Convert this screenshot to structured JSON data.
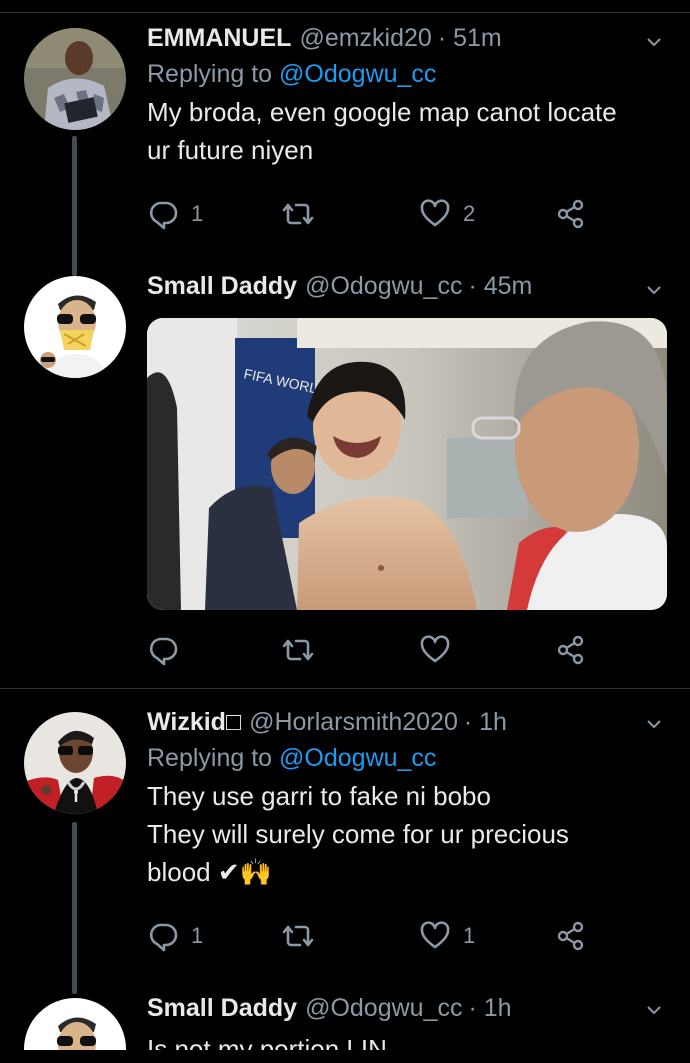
{
  "tweets": [
    {
      "name": "EMMANUEL",
      "handle": "@emzkid20",
      "time": "· 51m",
      "replying_prefix": "Replying to",
      "replying_to": "@Odogwu_cc",
      "text_lines": [
        "My broda, even google map canot locate",
        "ur future niyen"
      ],
      "reply_count": "1",
      "retweet_count": "",
      "like_count": "2"
    },
    {
      "name": "Small Daddy",
      "handle": "@Odogwu_cc",
      "time": "· 45m",
      "reply_count": "",
      "retweet_count": "",
      "like_count": ""
    },
    {
      "name": "Wizkid",
      "name_suffix": "□",
      "handle": "@Horlarsmith2020",
      "time": "· 1h",
      "replying_prefix": "Replying to",
      "replying_to": "@Odogwu_cc",
      "text_lines": [
        "They use garri to fake ni bobo",
        "They will surely come for ur precious",
        "blood ✔🙌"
      ],
      "reply_count": "1",
      "retweet_count": "",
      "like_count": "1"
    },
    {
      "name": "Small Daddy",
      "handle": "@Odogwu_cc",
      "time": "· 1h",
      "text_lines": [
        "Is not my portion LIN"
      ]
    }
  ],
  "icons": {
    "reply": "reply-icon",
    "retweet": "retweet-icon",
    "like": "heart-icon",
    "share": "share-icon",
    "more": "chevron-down-icon"
  },
  "colors": {
    "background": "#000000",
    "text": "#e7e9ea",
    "secondary": "#8b98a5",
    "mention": "#1d9bf0",
    "divider": "#2f3336"
  }
}
